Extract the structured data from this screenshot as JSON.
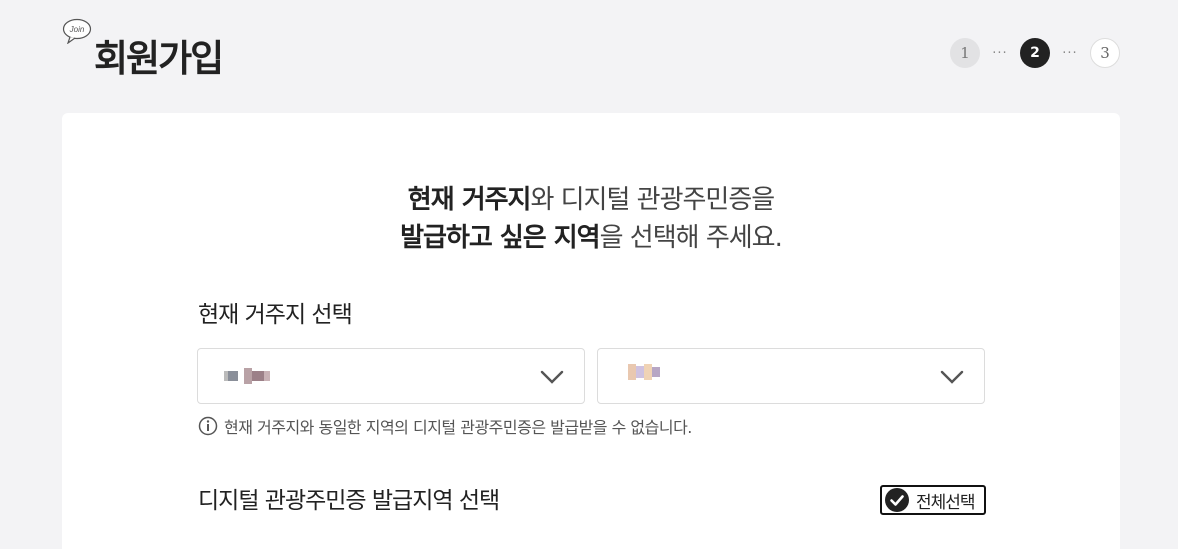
{
  "header": {
    "badge": "Join",
    "title": "회원가입",
    "steps": [
      {
        "label": "1",
        "state": "done"
      },
      {
        "label": "2",
        "state": "active"
      },
      {
        "label": "3",
        "state": "todo"
      }
    ]
  },
  "intro": {
    "line1_bold": "현재 거주지",
    "line1_rest": "와 디지털 관광주민증을",
    "line2_bold": "발급하고 싶은 지역",
    "line2_rest": "을 선택해 주세요."
  },
  "residence": {
    "label": "현재 거주지 선택",
    "notice": "현재 거주지와 동일한 지역의 디지털 관광주민증은 발급받을 수 없습니다."
  },
  "issue_region": {
    "label": "디지털 관광주민증 발급지역 선택",
    "select_all_label": "전체선택"
  },
  "icons": {
    "select_chevron": "chevron-down-icon",
    "notice": "info-icon",
    "select_all": "check-circle-icon",
    "badge": "speech-bubble-icon"
  },
  "colors": {
    "background": "#f3f3f5",
    "card": "#ffffff",
    "active_step": "#222222"
  }
}
